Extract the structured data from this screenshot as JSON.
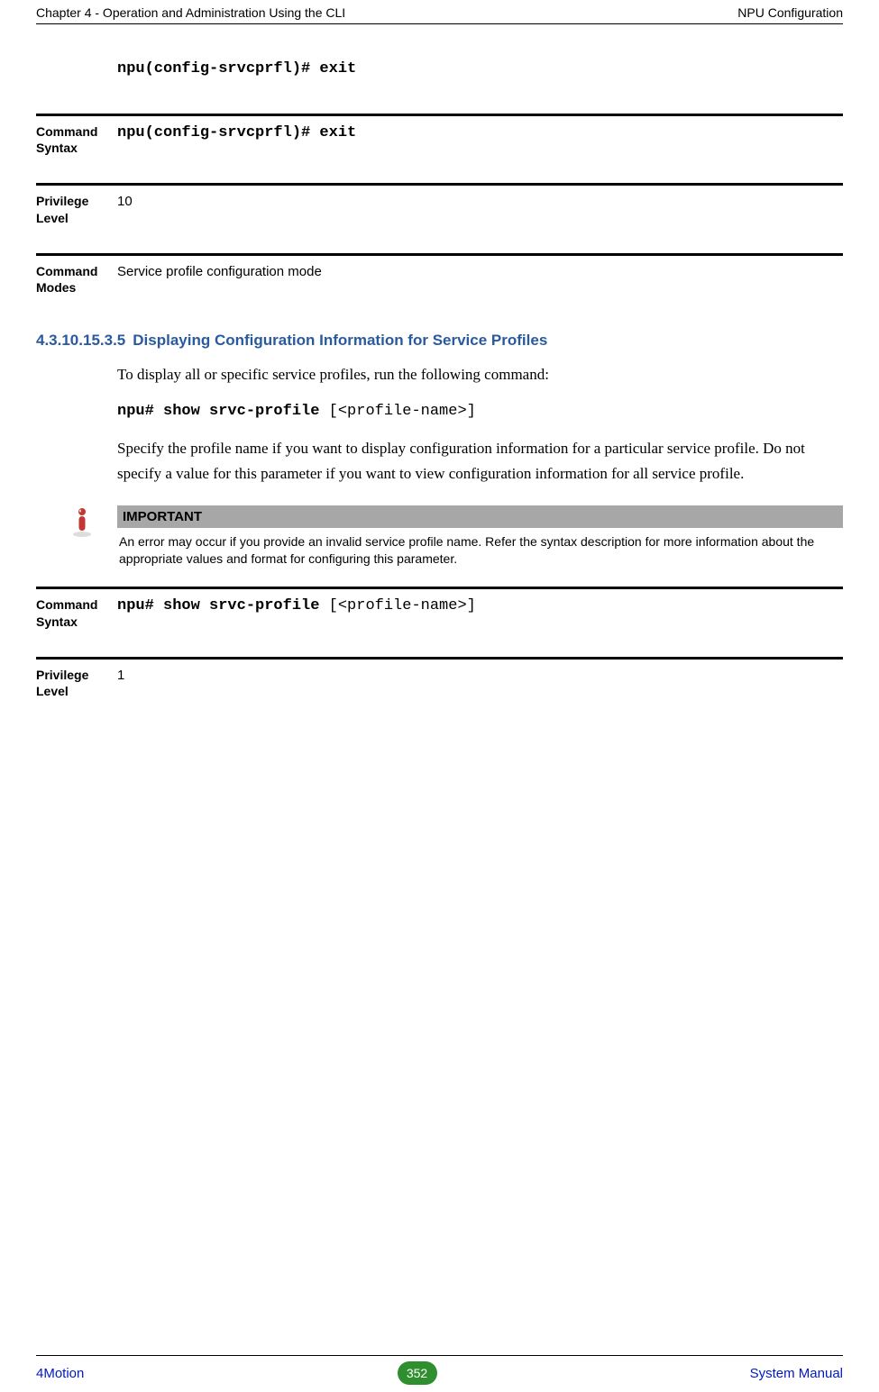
{
  "header": {
    "left": "Chapter 4 - Operation and Administration Using the CLI",
    "right": "NPU Configuration"
  },
  "topCmd": "npu(config-srvcprfl)# exit",
  "defs1": [
    {
      "label": "Command Syntax",
      "value": "npu(config-srvcprfl)# exit",
      "mono": true
    },
    {
      "label": "Privilege Level",
      "value": "10",
      "mono": false
    },
    {
      "label": "Command Modes",
      "value": "Service profile configuration mode",
      "mono": false
    }
  ],
  "section": {
    "number": "4.3.10.15.3.5",
    "title": "Displaying Configuration Information for Service Profiles"
  },
  "para1": " To display all or specific service profiles, run the following command:",
  "showCmd": {
    "bold": "npu# show srvc-profile ",
    "arg": "[<profile-name>]"
  },
  "para2": "Specify the profile name if you want to display configuration information for a particular service profile. Do not specify a value for this parameter if you want to view configuration information for all service profile.",
  "important": {
    "label": "IMPORTANT",
    "text": "An error may occur if you provide an invalid service profile name. Refer the syntax description for more information about the appropriate values and format for configuring this parameter."
  },
  "defs2": [
    {
      "label": "Command Syntax",
      "value_bold": "npu# show srvc-profile ",
      "value_arg": "[<profile-name>]",
      "mono": true
    },
    {
      "label": "Privilege Level",
      "value": "1",
      "mono": false
    }
  ],
  "footer": {
    "left": "4Motion",
    "page": "352",
    "right": "System Manual"
  }
}
